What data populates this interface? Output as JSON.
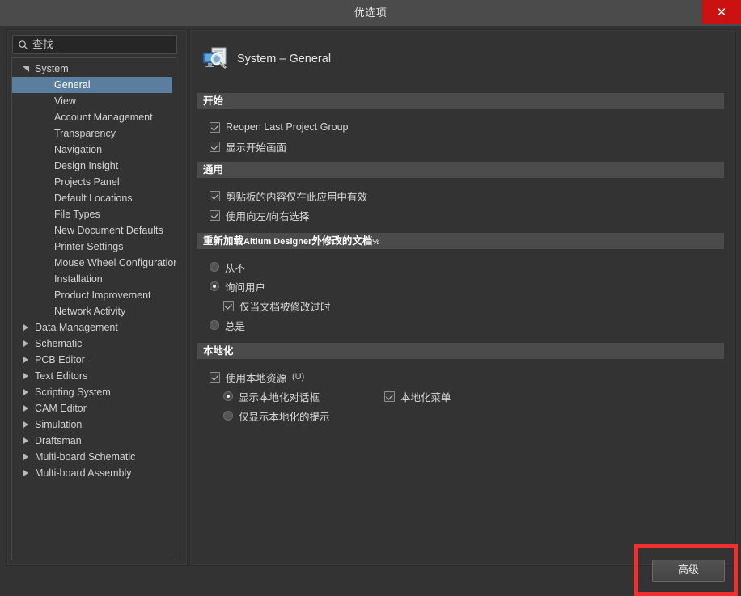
{
  "window": {
    "title": "优选项",
    "close_label": "✕"
  },
  "search": {
    "placeholder": "查找",
    "value": "",
    "icon": "search-icon"
  },
  "tree": {
    "items": [
      {
        "label": "System",
        "level": 0,
        "twisty": "expanded",
        "selected": false
      },
      {
        "label": "General",
        "level": 1,
        "twisty": "none",
        "selected": true
      },
      {
        "label": "View",
        "level": 1,
        "twisty": "none",
        "selected": false
      },
      {
        "label": "Account Management",
        "level": 1,
        "twisty": "none",
        "selected": false
      },
      {
        "label": "Transparency",
        "level": 1,
        "twisty": "none",
        "selected": false
      },
      {
        "label": "Navigation",
        "level": 1,
        "twisty": "none",
        "selected": false
      },
      {
        "label": "Design Insight",
        "level": 1,
        "twisty": "none",
        "selected": false
      },
      {
        "label": "Projects Panel",
        "level": 1,
        "twisty": "none",
        "selected": false
      },
      {
        "label": "Default Locations",
        "level": 1,
        "twisty": "none",
        "selected": false
      },
      {
        "label": "File Types",
        "level": 1,
        "twisty": "none",
        "selected": false
      },
      {
        "label": "New Document Defaults",
        "level": 1,
        "twisty": "none",
        "selected": false
      },
      {
        "label": "Printer Settings",
        "level": 1,
        "twisty": "none",
        "selected": false
      },
      {
        "label": "Mouse Wheel Configuration",
        "level": 1,
        "twisty": "none",
        "selected": false
      },
      {
        "label": "Installation",
        "level": 1,
        "twisty": "none",
        "selected": false
      },
      {
        "label": "Product Improvement",
        "level": 1,
        "twisty": "none",
        "selected": false
      },
      {
        "label": "Network Activity",
        "level": 1,
        "twisty": "none",
        "selected": false
      },
      {
        "label": "Data Management",
        "level": 0,
        "twisty": "collapsed",
        "selected": false
      },
      {
        "label": "Schematic",
        "level": 0,
        "twisty": "collapsed",
        "selected": false
      },
      {
        "label": "PCB Editor",
        "level": 0,
        "twisty": "collapsed",
        "selected": false
      },
      {
        "label": "Text Editors",
        "level": 0,
        "twisty": "collapsed",
        "selected": false
      },
      {
        "label": "Scripting System",
        "level": 0,
        "twisty": "collapsed",
        "selected": false
      },
      {
        "label": "CAM Editor",
        "level": 0,
        "twisty": "collapsed",
        "selected": false
      },
      {
        "label": "Simulation",
        "level": 0,
        "twisty": "collapsed",
        "selected": false
      },
      {
        "label": "Draftsman",
        "level": 0,
        "twisty": "collapsed",
        "selected": false
      },
      {
        "label": "Multi-board Schematic",
        "level": 0,
        "twisty": "collapsed",
        "selected": false
      },
      {
        "label": "Multi-board Assembly",
        "level": 0,
        "twisty": "collapsed",
        "selected": false
      }
    ]
  },
  "page": {
    "heading": "System – General",
    "heading_icon": "system-general-icon",
    "sections": {
      "startup": {
        "title": "开始",
        "options": [
          {
            "label": "Reopen Last Project Group",
            "checked": true
          },
          {
            "label": "显示开始画面",
            "checked": true
          }
        ]
      },
      "general": {
        "title": "通用",
        "options": [
          {
            "label": "剪贴板的内容仅在此应用中有效",
            "checked": true
          },
          {
            "label": "使用向左/向右选择",
            "checked": true
          }
        ]
      },
      "reload": {
        "title_pre": "重新加载",
        "title_en": "Altium Designer",
        "title_post": "外修改的文档",
        "title_suffix": "%",
        "options": [
          {
            "label": "从不",
            "checked": false
          },
          {
            "label": "询问用户",
            "checked": true
          },
          {
            "label": "仅当文档被修改过时",
            "checked": true
          },
          {
            "label": "总是",
            "checked": false
          }
        ]
      },
      "localization": {
        "title": "本地化",
        "use_local": {
          "label": "使用本地资源",
          "key": "(U)",
          "checked": true
        },
        "show_dialog": {
          "label": "显示本地化对话框",
          "checked": true
        },
        "hints_only": {
          "label": "仅显示本地化的提示",
          "checked": false
        },
        "local_menu": {
          "label": "本地化菜单",
          "checked": true
        }
      }
    }
  },
  "footer": {
    "advanced_label": "高级"
  },
  "annotation": {
    "highlight_color": "#f03030"
  },
  "colors": {
    "accent_selection": "#5c7e9e",
    "window_bg": "#333333",
    "section_header_bg": "#4b4b4b",
    "close_red": "#cc1111"
  }
}
